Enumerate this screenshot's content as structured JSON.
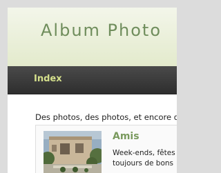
{
  "header": {
    "title": "Album Photo"
  },
  "nav": {
    "items": [
      {
        "label": "Index"
      }
    ]
  },
  "main": {
    "intro": "Des photos, des photos, et encore d",
    "albums": [
      {
        "title": "Amis",
        "description_line1": "Week-ends, fêtes",
        "description_line2": "toujours de bons"
      }
    ]
  },
  "colors": {
    "header_bg": "#e3eacc",
    "title_text": "#6f8d5c",
    "nav_bg": "#3a3a3a",
    "nav_link": "#d5e08c",
    "album_title": "#7a9a5e"
  }
}
